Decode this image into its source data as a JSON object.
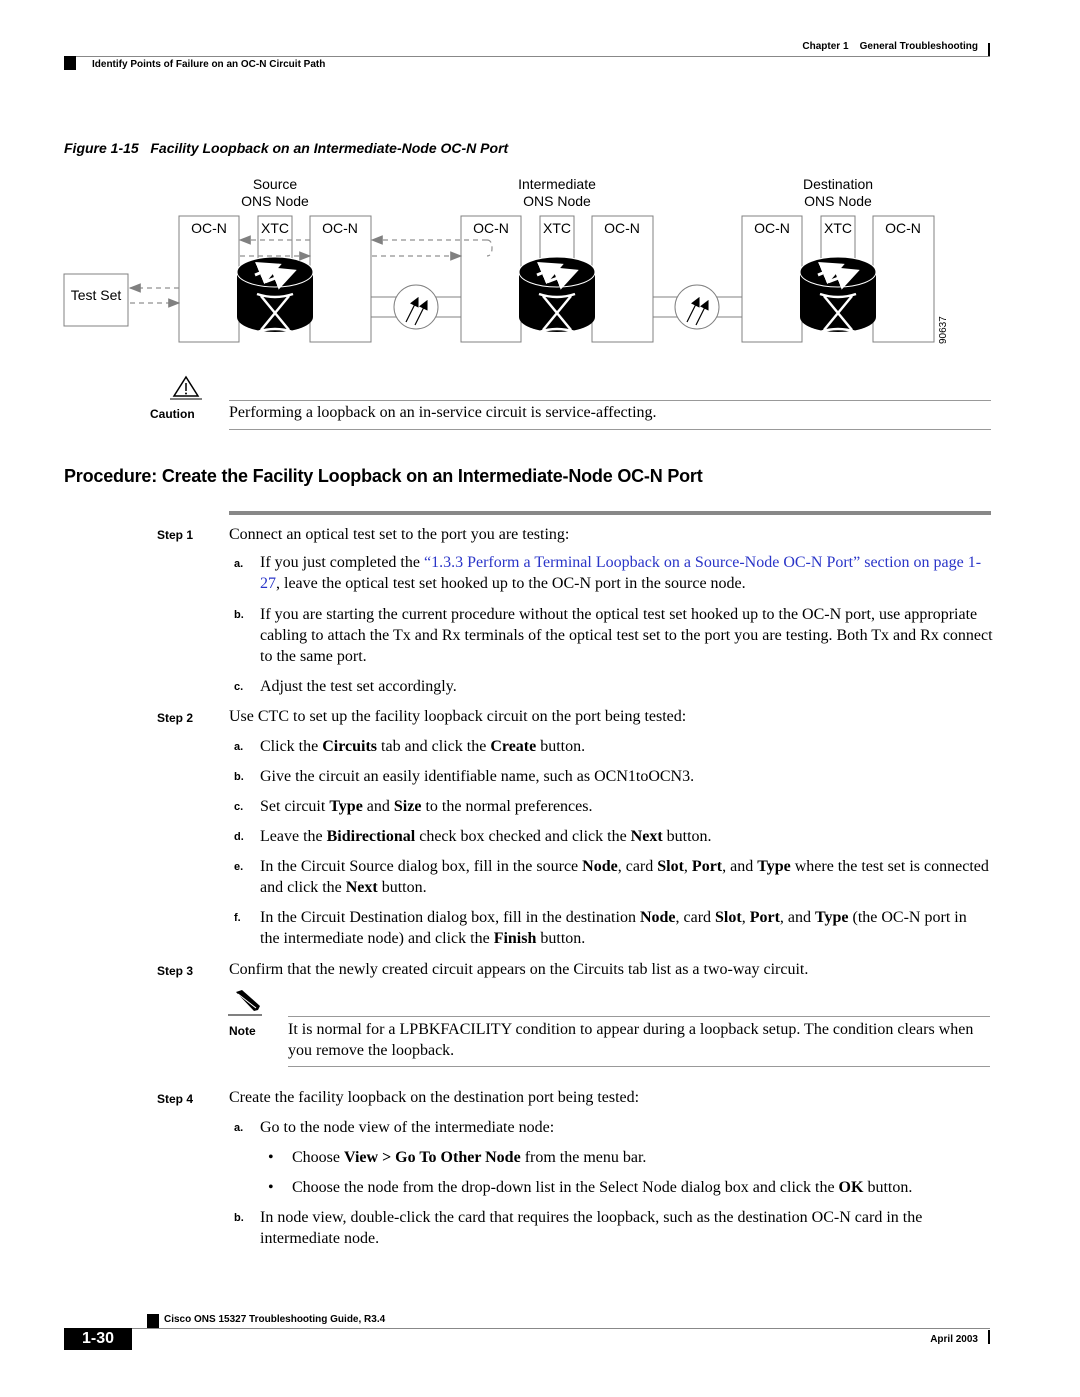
{
  "header": {
    "chapter": "Chapter 1",
    "chapter_title": "General Troubleshooting",
    "section": "Identify Points of Failure on an OC-N Circuit Path"
  },
  "figure": {
    "caption": "Figure 1-15   Facility Loopback on an Intermediate-Node OC-N Port",
    "nodes": [
      {
        "line1": "Source",
        "line2": "ONS Node"
      },
      {
        "line1": "Intermediate",
        "line2": "ONS Node"
      },
      {
        "line1": "Destination",
        "line2": "ONS Node"
      }
    ],
    "card_ocn": "OC-N",
    "card_xtc": "XTC",
    "test_set": "Test Set",
    "figure_id": "90637"
  },
  "caution": {
    "label": "Caution",
    "text": "Performing a loopback on an in-service circuit is service-affecting."
  },
  "procedure": {
    "title": "Procedure: Create the Facility Loopback on an Intermediate-Node OC-N Port",
    "steps": [
      {
        "label": "Step 1",
        "text": "Connect an optical test set to the port you are testing:",
        "subs": [
          {
            "letter": "a.",
            "pre": "If you just completed the ",
            "link": "“1.3.3 Perform a Terminal Loopback on a Source-Node OC-N Port” section on page 1-27",
            "post": ", leave the optical test set hooked up to the OC-N port in the source node."
          },
          {
            "letter": "b.",
            "text": "If you are starting the current procedure without the optical test set hooked up to the OC-N port, use appropriate cabling to attach the Tx and Rx terminals of the optical test set to the port you are testing. Both Tx and Rx connect to the same port."
          },
          {
            "letter": "c.",
            "text": "Adjust the test set accordingly."
          }
        ]
      },
      {
        "label": "Step 2",
        "text": "Use CTC to set up the facility loopback circuit on the port being tested:",
        "subs": [
          {
            "letter": "a.",
            "t1": "Click the ",
            "b1": "Circuits",
            "t2": " tab and click the ",
            "b2": "Create",
            "t3": " button."
          },
          {
            "letter": "b.",
            "text": "Give the circuit an easily identifiable name, such as OCN1toOCN3."
          },
          {
            "letter": "c.",
            "t1": "Set circuit ",
            "b1": "Type",
            "t2": " and ",
            "b2": "Size",
            "t3": " to the normal preferences."
          },
          {
            "letter": "d.",
            "t1": "Leave the ",
            "b1": "Bidirectional",
            "t2": " check box checked and click the ",
            "b2": "Next",
            "t3": " button."
          },
          {
            "letter": "e.",
            "t1": "In the Circuit Source dialog box, fill in the source ",
            "b1": "Node",
            "t2": ", card ",
            "b2": "Slot",
            "t3": ", ",
            "b3": "Port",
            "t4": ", and ",
            "b4": "Type",
            "t5": " where the test set is connected and click the ",
            "b5": "Next",
            "t6": " button."
          },
          {
            "letter": "f.",
            "t1": "In the Circuit Destination dialog box, fill in the destination ",
            "b1": "Node",
            "t2": ", card ",
            "b2": "Slot",
            "t3": ", ",
            "b3": "Port",
            "t4": ", and ",
            "b4": "Type",
            "t5": " (the OC-N port in the intermediate node) and click the ",
            "b5": "Finish",
            "t6": " button."
          }
        ]
      },
      {
        "label": "Step 3",
        "text": "Confirm that the newly created circuit appears on the Circuits tab list as a two-way circuit."
      },
      {
        "label": "Step 4",
        "text": "Create the facility loopback on the destination port being tested:",
        "subs": [
          {
            "letter": "a.",
            "text": "Go to the node view of the intermediate node:",
            "bullets": [
              {
                "t1": "Choose ",
                "b1": "View > Go To Other Node",
                "t2": " from the menu bar."
              },
              {
                "t1": "Choose the node from the drop-down list in the Select Node dialog box and click the ",
                "b1": "OK",
                "t2": " button."
              }
            ]
          },
          {
            "letter": "b.",
            "text": "In node view, double-click the card that requires the loopback, such as the destination OC-N card in the intermediate node."
          }
        ]
      }
    ]
  },
  "note": {
    "label": "Note",
    "text": "It is normal for a LPBKFACILITY condition to appear during a loopback setup. The condition clears when you remove the loopback."
  },
  "footer": {
    "guide_title": "Cisco ONS 15327 Troubleshooting Guide, R3.4",
    "page_number": "1-30",
    "date": "April 2003"
  }
}
